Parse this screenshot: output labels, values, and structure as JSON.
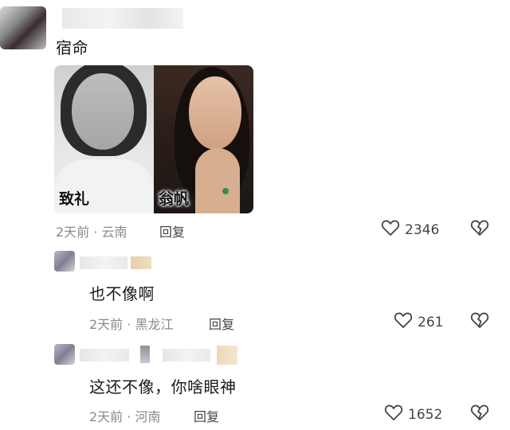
{
  "comments": [
    {
      "text": "宿命",
      "images": [
        {
          "label": "致礼"
        },
        {
          "label": "翁帆"
        }
      ],
      "meta": "2天前 · 云南",
      "reply_label": "回复",
      "likes": "2346"
    },
    {
      "text": "也不像啊",
      "meta": "2天前 · 黑龙江",
      "reply_label": "回复",
      "likes": "261"
    },
    {
      "text": "这还不像，你啥眼神",
      "meta": "2天前 · 河南",
      "reply_label": "回复",
      "likes": "1652"
    }
  ],
  "icons": {
    "like": "heart-icon",
    "dislike": "broken-heart-icon"
  },
  "colors": {
    "meta_text": "#8a8a8a",
    "icon_stroke": "#444444"
  }
}
